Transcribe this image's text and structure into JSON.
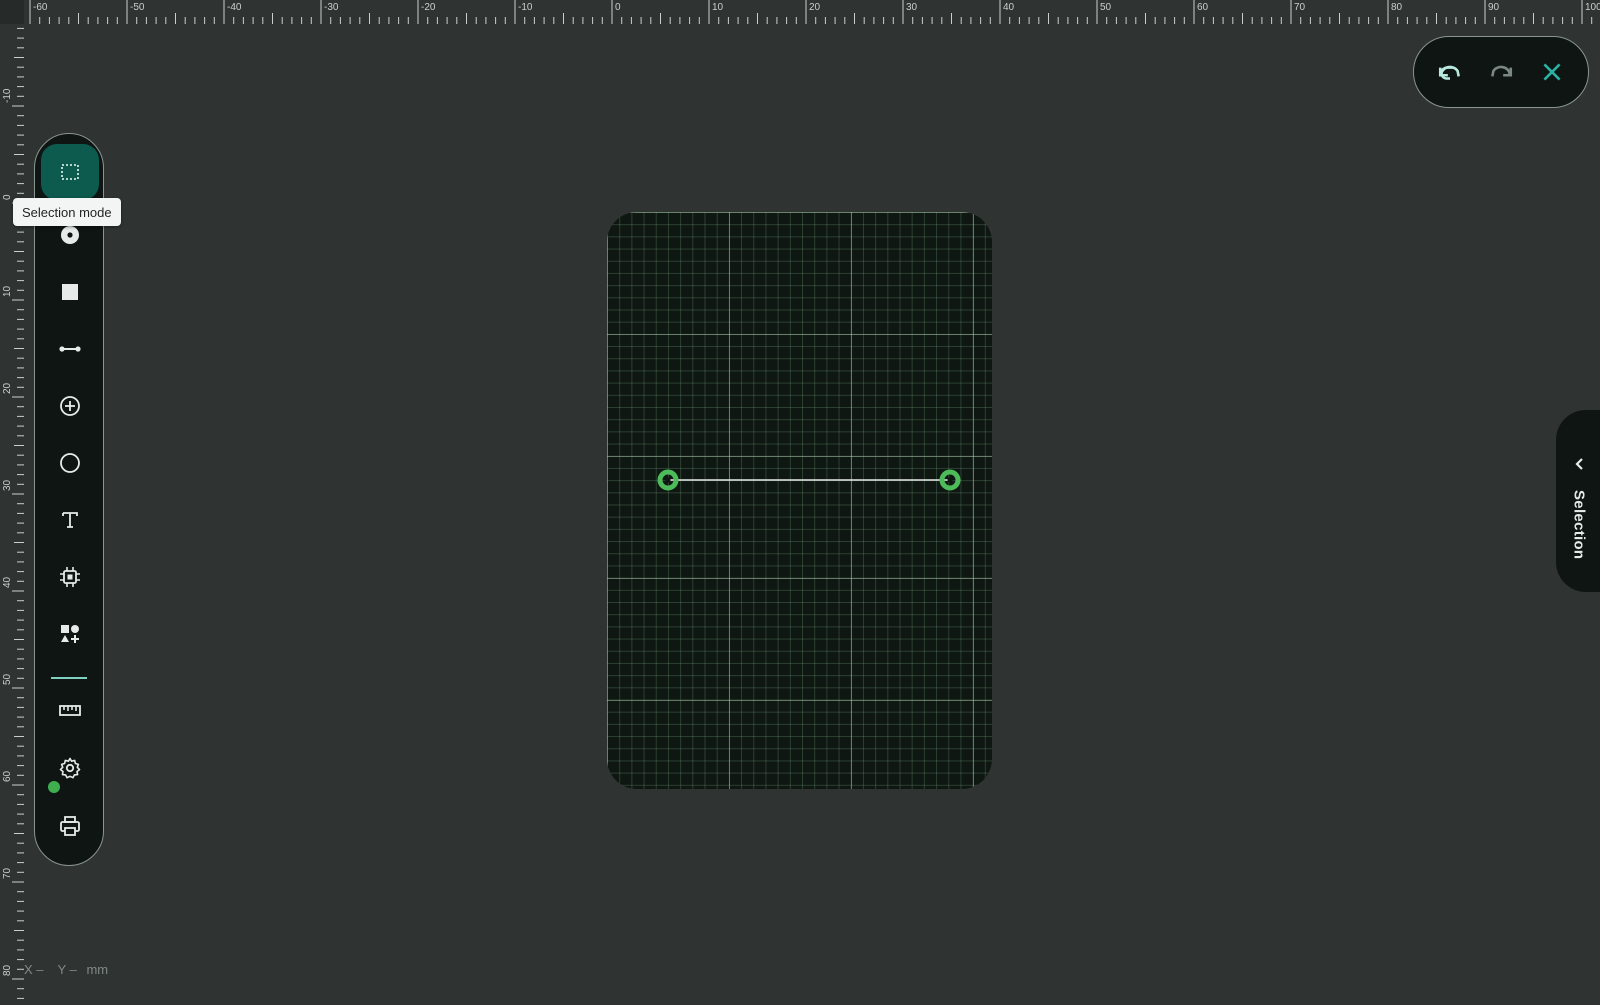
{
  "ruler": {
    "top_labels": [
      "-60",
      "-50",
      "-40",
      "-30",
      "-20",
      "-10",
      "0",
      "10",
      "20",
      "30",
      "40",
      "50",
      "60",
      "70",
      "80",
      "90",
      "100"
    ],
    "left_labels": [
      "-10",
      "0",
      "10",
      "20",
      "30",
      "40",
      "50",
      "60",
      "70",
      "80"
    ],
    "unit": "mm"
  },
  "toolbar": {
    "tools": [
      {
        "name": "selection-tool",
        "icon": "dashed-rectangle-icon",
        "active": true
      },
      {
        "name": "pad-tool",
        "icon": "target-dot-icon"
      },
      {
        "name": "rectangle-tool",
        "icon": "filled-square-icon"
      },
      {
        "name": "wire-tool",
        "icon": "line-endpoints-icon"
      },
      {
        "name": "via-tool",
        "icon": "circle-plus-icon"
      },
      {
        "name": "circle-tool",
        "icon": "circle-outline-icon"
      },
      {
        "name": "text-tool",
        "icon": "text-t-icon"
      },
      {
        "name": "component-tool",
        "icon": "chip-icon"
      },
      {
        "name": "shapes-tool",
        "icon": "shapes-icon"
      },
      {
        "name": "measure-tool",
        "icon": "ruler-icon"
      },
      {
        "name": "settings-tool",
        "icon": "gear-icon"
      },
      {
        "name": "print-tool",
        "icon": "printer-icon"
      }
    ],
    "tooltip": "Selection mode",
    "status_color": "#3fae4f",
    "accent_color": "#0d5a4f"
  },
  "actions": {
    "undo": "undo-icon",
    "redo": "redo-icon",
    "close": "close-icon"
  },
  "side_panel": {
    "label": "Selection"
  },
  "coords": {
    "x_label": "X",
    "x_value": "–",
    "y_label": "Y",
    "y_value": "–",
    "unit": "mm"
  },
  "board": {
    "background": "#0f1712",
    "wire_color": "#e8ece9",
    "endpoint_color": "#4dbb5a"
  }
}
